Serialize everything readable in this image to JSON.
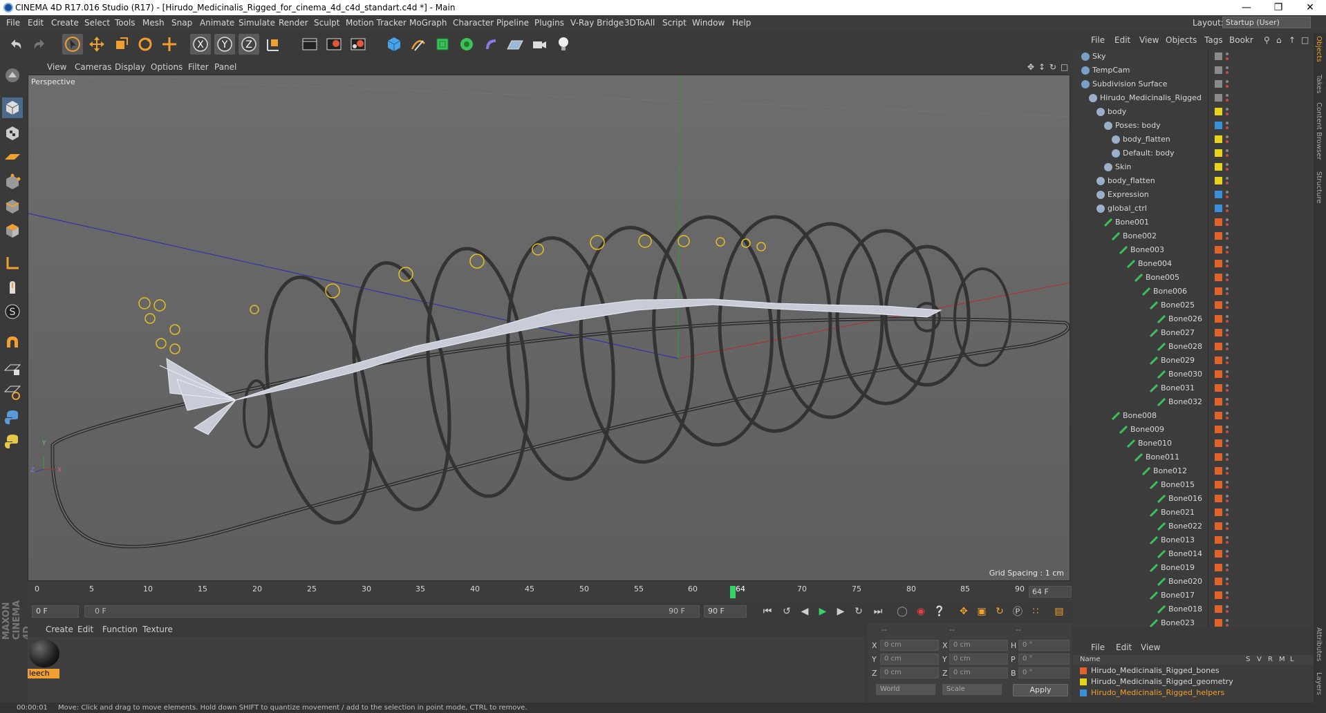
{
  "window": {
    "title": "CINEMA 4D R17.016 Studio (R17) - [Hirudo_Medicinalis_Rigged_for_cinema_4d_c4d_standart.c4d *] - Main",
    "buttons": [
      "minimize-icon",
      "restore-icon",
      "close-icon"
    ]
  },
  "menubar": {
    "items": [
      "File",
      "Edit",
      "Create",
      "Select",
      "Tools",
      "Mesh",
      "Snap",
      "Animate",
      "Simulate",
      "Render",
      "Sculpt",
      "Motion Tracker",
      "MoGraph",
      "Character",
      "Pipeline",
      "Plugins",
      "V-Ray Bridge",
      "3DToAll",
      "Script",
      "Window",
      "Help"
    ],
    "layout_label": "Layout:",
    "layout_value": "Startup (User)"
  },
  "viewport": {
    "menu": [
      "View",
      "Cameras",
      "Display",
      "Options",
      "Filter",
      "Panel"
    ],
    "label": "Perspective",
    "grid_spacing": "Grid Spacing : 1 cm",
    "axis_labels": [
      "Y",
      "Z",
      "X"
    ]
  },
  "timeline": {
    "ticks": [
      "0",
      "5",
      "10",
      "15",
      "20",
      "25",
      "30",
      "35",
      "40",
      "45",
      "50",
      "55",
      "60",
      "64",
      "70",
      "75",
      "80",
      "85",
      "90"
    ],
    "current_frame": 64,
    "end_field": "64 F",
    "start_field": "0 F",
    "range_start": "0 F",
    "range_end": "90 F",
    "max_field": "90 F"
  },
  "material_panel": {
    "menu": [
      "Create",
      "Edit",
      "Function",
      "Texture"
    ],
    "material_name": "leech"
  },
  "coordinates": {
    "header": [
      "--",
      "--",
      "--"
    ],
    "rows": [
      {
        "a": "X",
        "av": "0 cm",
        "b": "X",
        "bv": "0 cm",
        "c": "H",
        "cv": "0 °"
      },
      {
        "a": "Y",
        "av": "0 cm",
        "b": "Y",
        "bv": "0 cm",
        "c": "P",
        "cv": "0 °"
      },
      {
        "a": "Z",
        "av": "0 cm",
        "b": "Z",
        "bv": "0 cm",
        "c": "B",
        "cv": "0 °"
      }
    ],
    "mode1": "World",
    "mode2": "Scale",
    "apply_label": "Apply"
  },
  "object_manager": {
    "menu": [
      "File",
      "Edit",
      "View",
      "Objects",
      "Tags",
      "Bookr"
    ],
    "objects": [
      {
        "name": "Sky",
        "depth": 0,
        "color": "#8a8a8a"
      },
      {
        "name": "TempCam",
        "depth": 0,
        "color": "#8a8a8a"
      },
      {
        "name": "Subdivision Surface",
        "depth": 0,
        "color": "#8a8a8a"
      },
      {
        "name": "Hirudo_Medicinalis_Rigged",
        "depth": 1,
        "color": "#8a8a8a"
      },
      {
        "name": "body",
        "depth": 2,
        "color": "#e6d21a"
      },
      {
        "name": "Poses: body",
        "depth": 3,
        "color": "#3a8fd8"
      },
      {
        "name": "body_flatten",
        "depth": 4,
        "color": "#e6d21a"
      },
      {
        "name": "Default: body",
        "depth": 4,
        "color": "#e6d21a"
      },
      {
        "name": "Skin",
        "depth": 3,
        "color": "#e6d21a"
      },
      {
        "name": "body_flatten",
        "depth": 2,
        "color": "#e6d21a"
      },
      {
        "name": "Expression",
        "depth": 2,
        "color": "#3a8fd8"
      },
      {
        "name": "global_ctrl",
        "depth": 2,
        "color": "#3a8fd8"
      },
      {
        "name": "Bone001",
        "depth": 3,
        "color": "#e0642a"
      },
      {
        "name": "Bone002",
        "depth": 4,
        "color": "#e0642a"
      },
      {
        "name": "Bone003",
        "depth": 5,
        "color": "#e0642a"
      },
      {
        "name": "Bone004",
        "depth": 6,
        "color": "#e0642a"
      },
      {
        "name": "Bone005",
        "depth": 7,
        "color": "#e0642a"
      },
      {
        "name": "Bone006",
        "depth": 8,
        "color": "#e0642a"
      },
      {
        "name": "Bone025",
        "depth": 9,
        "color": "#e0642a"
      },
      {
        "name": "Bone026",
        "depth": 10,
        "color": "#e0642a"
      },
      {
        "name": "Bone027",
        "depth": 9,
        "color": "#e0642a"
      },
      {
        "name": "Bone028",
        "depth": 10,
        "color": "#e0642a"
      },
      {
        "name": "Bone029",
        "depth": 9,
        "color": "#e0642a"
      },
      {
        "name": "Bone030",
        "depth": 10,
        "color": "#e0642a"
      },
      {
        "name": "Bone031",
        "depth": 9,
        "color": "#e0642a"
      },
      {
        "name": "Bone032",
        "depth": 10,
        "color": "#e0642a"
      },
      {
        "name": "Bone008",
        "depth": 4,
        "color": "#e0642a"
      },
      {
        "name": "Bone009",
        "depth": 5,
        "color": "#e0642a"
      },
      {
        "name": "Bone010",
        "depth": 6,
        "color": "#e0642a"
      },
      {
        "name": "Bone011",
        "depth": 7,
        "color": "#e0642a"
      },
      {
        "name": "Bone012",
        "depth": 8,
        "color": "#e0642a"
      },
      {
        "name": "Bone015",
        "depth": 9,
        "color": "#e0642a"
      },
      {
        "name": "Bone016",
        "depth": 10,
        "color": "#e0642a"
      },
      {
        "name": "Bone021",
        "depth": 9,
        "color": "#e0642a"
      },
      {
        "name": "Bone022",
        "depth": 10,
        "color": "#e0642a"
      },
      {
        "name": "Bone013",
        "depth": 9,
        "color": "#e0642a"
      },
      {
        "name": "Bone014",
        "depth": 10,
        "color": "#e0642a"
      },
      {
        "name": "Bone019",
        "depth": 9,
        "color": "#e0642a"
      },
      {
        "name": "Bone020",
        "depth": 10,
        "color": "#e0642a"
      },
      {
        "name": "Bone017",
        "depth": 9,
        "color": "#e0642a"
      },
      {
        "name": "Bone018",
        "depth": 10,
        "color": "#e0642a"
      },
      {
        "name": "Bone023",
        "depth": 9,
        "color": "#e0642a"
      }
    ]
  },
  "layer_manager": {
    "menu": [
      "File",
      "Edit",
      "View"
    ],
    "header": {
      "name": "Name",
      "cols": [
        "S",
        "V",
        "R",
        "M",
        "L"
      ]
    },
    "layers": [
      {
        "name": "Hirudo_Medicinalis_Rigged_bones",
        "color": "#e0642a",
        "active": false
      },
      {
        "name": "Hirudo_Medicinalis_Rigged_geometry",
        "color": "#e6d21a",
        "active": false
      },
      {
        "name": "Hirudo_Medicinalis_Rigged_helpers",
        "color": "#3a8fd8",
        "active": true
      }
    ]
  },
  "right_tabs": [
    "Objects",
    "Takes",
    "Content Browser",
    "Structure",
    "Attributes",
    "Layers"
  ],
  "status": {
    "time": "00:00:01",
    "message": "Move: Click and drag to move elements. Hold down SHIFT to quantize movement / add to the selection in point mode, CTRL to remove."
  },
  "colors": {
    "accent": "#f0a030",
    "active_layer_text": "#f0a030",
    "playhead": "#36d36a"
  }
}
